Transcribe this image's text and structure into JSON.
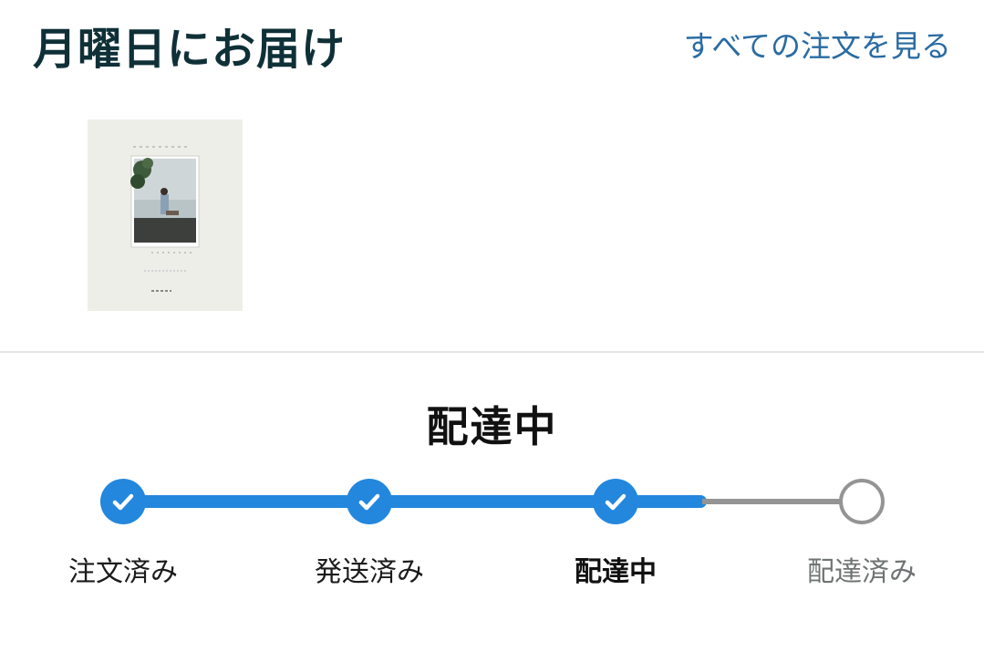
{
  "header": {
    "delivery_title": "月曜日にお届け",
    "all_orders_link": "すべての注文を見る"
  },
  "product": {
    "thumbnail_icon": "book-cover-photo"
  },
  "status": {
    "heading": "配達中"
  },
  "tracker": {
    "accent_color": "#2387dd",
    "inactive_color": "#949494",
    "progress_steps_completed": 3,
    "steps": [
      {
        "label": "注文済み",
        "state": "done",
        "icon": "check-icon"
      },
      {
        "label": "発送済み",
        "state": "done",
        "icon": "check-icon"
      },
      {
        "label": "配達中",
        "state": "current",
        "icon": "check-icon"
      },
      {
        "label": "配達済み",
        "state": "pending",
        "icon": "empty-circle-icon"
      }
    ]
  }
}
